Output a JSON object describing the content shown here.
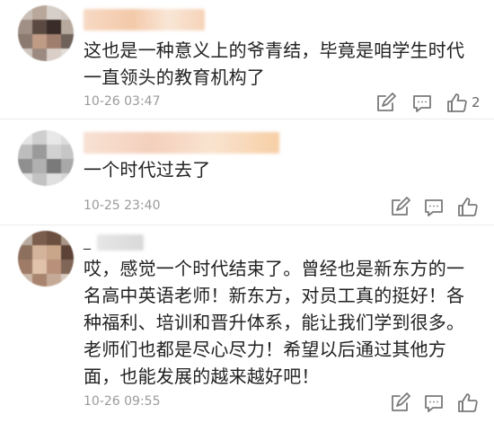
{
  "comments": [
    {
      "text": "这也是一种意义上的爷青结，毕竟是咱学生时代一直领头的教育机构了",
      "timestamp": "10-26 03:47",
      "like_count": "2"
    },
    {
      "text": "一个时代过去了",
      "timestamp": "10-25 23:40",
      "like_count": ""
    },
    {
      "username_visible": "_",
      "text": "哎，感觉一个时代结束了。曾经也是新东方的一名高中英语老师！新东方，对员工真的挺好！各种福利、培训和晋升体系，能让我们学到很多。老师们也都是尽心尽力！希望以后通过其他方面，也能发展的越来越好吧！",
      "timestamp": "10-26 09:55",
      "like_count": ""
    }
  ],
  "icons": {
    "forward": "forward-icon",
    "comment": "comment-icon",
    "like": "thumbs-up-icon"
  },
  "colors": {
    "text": "#222222",
    "meta": "#9a9a9a",
    "icon": "#7a7a7a",
    "divider": "#ececec"
  }
}
